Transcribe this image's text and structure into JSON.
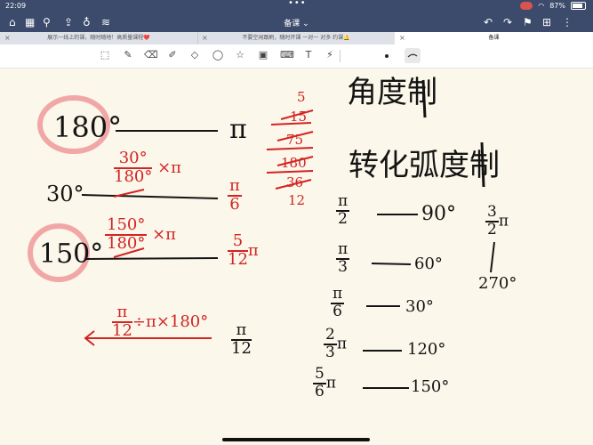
{
  "status_bar": {
    "time": "22:09",
    "battery": "87%"
  },
  "nav": {
    "title": "备课 ⌄",
    "icons_left": [
      "home-icon",
      "grid-icon",
      "search-icon",
      "share-icon",
      "mic-icon",
      "waveform-icon"
    ],
    "icons_right": [
      "undo-icon",
      "redo-icon",
      "bookmark-icon",
      "add-page-icon",
      "more-icon"
    ]
  },
  "tabs": [
    {
      "label": "展示一线上的课，随时随地！高质量课程❤️",
      "active": false
    },
    {
      "label": "不要空闲跟刷，随时开课 一对一 对多 约课🔔",
      "active": false
    },
    {
      "label": "备课",
      "active": true
    }
  ],
  "toolbar": {
    "tools": [
      "lasso-select-icon",
      "pen-icon",
      "eraser-icon",
      "highlighter-icon",
      "shapes-icon",
      "lasso-icon",
      "star-icon",
      "image-icon",
      "keyboard-icon",
      "text-icon",
      "laser-pointer-icon"
    ],
    "active_color": "#222222"
  },
  "notes": {
    "heading_1": "角度制",
    "heading_2": "转化弧度制",
    "row_180": {
      "left": "180°",
      "right": "π"
    },
    "row_30": {
      "calc_num": "30°",
      "calc_den": "180°",
      "calc_tail": "×π",
      "left": "30°",
      "res_num": "π",
      "res_den": "6"
    },
    "row_150": {
      "calc_num": "150°",
      "calc_den": "180°",
      "calc_tail": "×π",
      "left": "150°",
      "res_num": "5",
      "res_den": "12",
      "res_tail": "π"
    },
    "reverse": {
      "calc_num": "π",
      "calc_den": "12",
      "calc_tail": "÷π×180°",
      "res_num": "π",
      "res_den": "12"
    },
    "division": {
      "divisor_top": "5",
      "dividend": "15",
      "layer_1": "75",
      "layer_2": "180",
      "layer_3": "36",
      "layer_4": "12"
    },
    "table": [
      {
        "num": "π",
        "den": "2",
        "tail": "",
        "deg": "90°"
      },
      {
        "num": "π",
        "den": "3",
        "tail": "",
        "deg": "60°"
      },
      {
        "num": "π",
        "den": "6",
        "tail": "",
        "deg": "30°"
      },
      {
        "num": "2",
        "den": "3",
        "tail": "π",
        "deg": "120°"
      },
      {
        "num": "5",
        "den": "6",
        "tail": "π",
        "deg": "150°"
      }
    ],
    "side": {
      "num": "3",
      "den": "2",
      "tail": "π",
      "deg": "270°"
    }
  },
  "colors": {
    "paper": "#fbf7ea",
    "ink_black": "#141414",
    "ink_red": "#d22424",
    "highlight_circle": "#f2a7a7",
    "chrome": "#3c4a6b"
  }
}
